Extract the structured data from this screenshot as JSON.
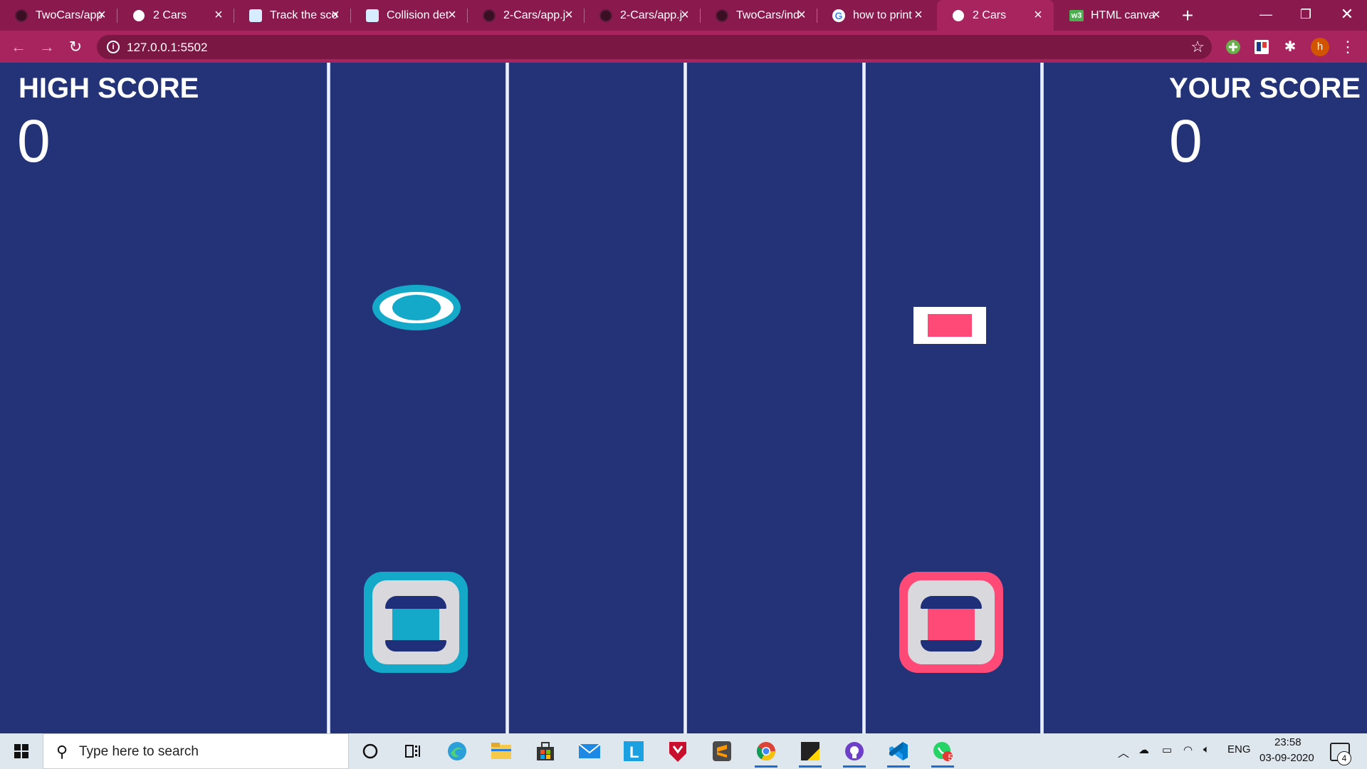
{
  "browser": {
    "tabs": [
      {
        "title": "TwoCars/app",
        "favicon": "github-icon"
      },
      {
        "title": "2 Cars",
        "favicon": "globe-icon"
      },
      {
        "title": "Track the sco",
        "favicon": "paw-icon"
      },
      {
        "title": "Collision det",
        "favicon": "paw-icon"
      },
      {
        "title": "2-Cars/app.j",
        "favicon": "github-icon"
      },
      {
        "title": "2-Cars/app.j",
        "favicon": "github-icon"
      },
      {
        "title": "TwoCars/ind",
        "favicon": "github-icon"
      },
      {
        "title": "how to print",
        "favicon": "google-icon"
      },
      {
        "title": "2 Cars",
        "favicon": "globe-icon",
        "active": true
      },
      {
        "title": "HTML canva",
        "favicon": "w3schools-icon"
      }
    ],
    "new_tab_label": "+",
    "url": "127.0.0.1:5502",
    "profile_initial": "h",
    "theme_color": "#a8245f",
    "tab_bar_color": "#8a1a4e"
  },
  "game": {
    "background_color": "#243278",
    "high_score_label": "HIGH SCORE",
    "high_score_value": "0",
    "your_score_label": "YOUR SCORE",
    "your_score_value": "0",
    "left_car_color": "#14a9c8",
    "right_car_color": "#ff4a78",
    "obstacles": [
      {
        "side": "left",
        "shape": "circle",
        "color": "#14a9c8"
      },
      {
        "side": "right",
        "shape": "square",
        "color": "#ff4a78"
      }
    ]
  },
  "taskbar": {
    "search_placeholder": "Type here to search",
    "apps": [
      "cortana-icon",
      "task-view-icon",
      "edge-icon",
      "file-explorer-icon",
      "store-icon",
      "mail-icon",
      "l-app-icon",
      "mcafee-icon",
      "sublime-icon",
      "chrome-icon",
      "sticky-notes-icon",
      "github-desktop-icon",
      "vscode-icon",
      "whatsapp-icon"
    ],
    "whatsapp_badge": "5",
    "language": "ENG",
    "time": "23:58",
    "date": "03-09-2020",
    "notification_count": "4"
  }
}
